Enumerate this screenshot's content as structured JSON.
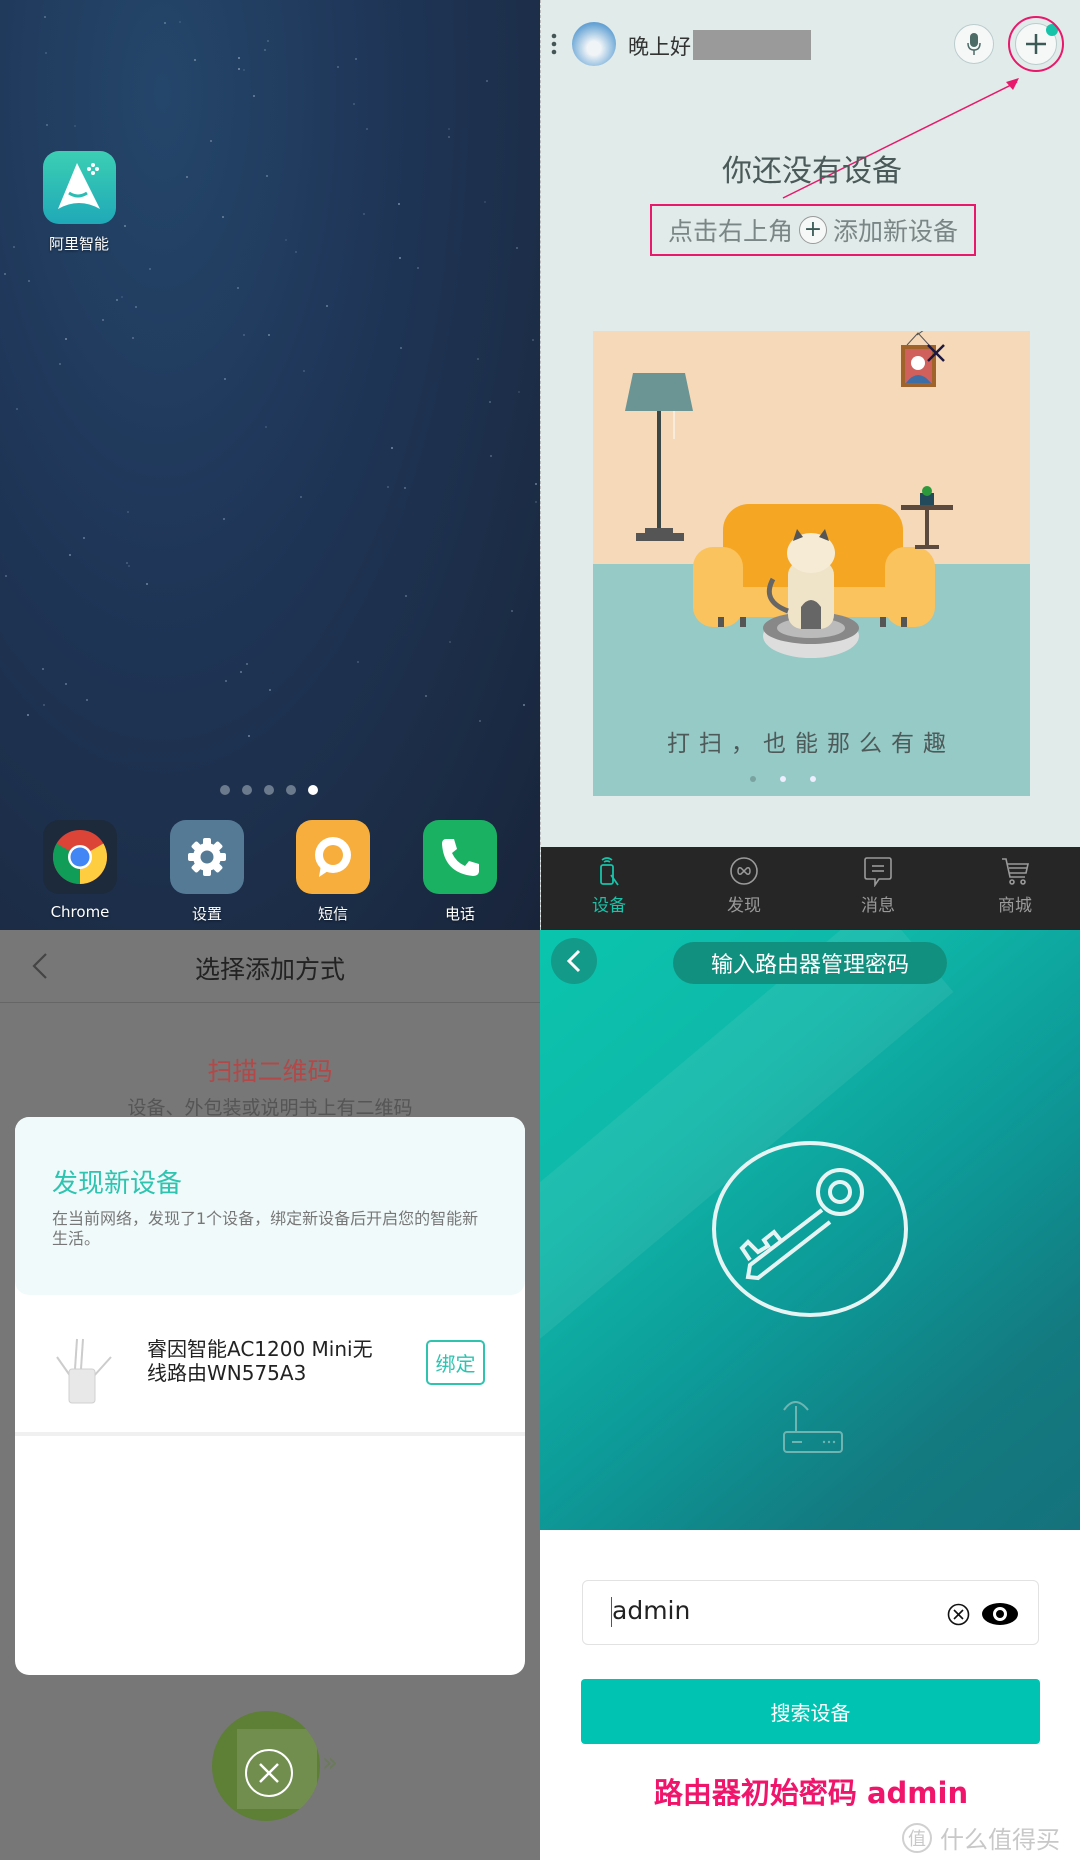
{
  "home_screen": {
    "app_icon_label": "阿里智能",
    "page_dots": {
      "count": 5,
      "active_index": 4
    },
    "dock": [
      {
        "label": "Chrome",
        "icon": "chrome-icon"
      },
      {
        "label": "设置",
        "icon": "gear-icon",
        "color": "#557a96"
      },
      {
        "label": "短信",
        "icon": "message-bubble-icon",
        "color": "#f7ae3c"
      },
      {
        "label": "电话",
        "icon": "phone-icon",
        "color": "#1bb163"
      }
    ]
  },
  "device_home": {
    "greeting": "晚上好",
    "empty_title": "你还没有设备",
    "hint_before": "点击右上角",
    "hint_after": "添加新设备",
    "banner": {
      "caption": "打扫，也能那么有趣",
      "dots": 3,
      "active_dot": 0
    },
    "nav": [
      {
        "label": "设备",
        "icon": "device-remote-icon",
        "active": true
      },
      {
        "label": "发现",
        "icon": "discover-icon",
        "active": false
      },
      {
        "label": "消息",
        "icon": "message-icon",
        "active": false
      },
      {
        "label": "商城",
        "icon": "cart-icon",
        "active": false
      }
    ],
    "accent": "#17c3a9",
    "annotation_color": "#e8186b"
  },
  "add_method": {
    "title": "选择添加方式",
    "scan_title": "扫描二维码",
    "scan_desc": "设备、外包装或说明书上有二维码",
    "dialog": {
      "title": "发现新设备",
      "desc": "在当前网络，发现了1个设备，绑定新设备后开启您的智能新生活。",
      "device_name_line1": "睿因智能AC1200 Mini无",
      "device_name_line2": "线路由WN575A3",
      "bind_label": "绑定"
    }
  },
  "router_password": {
    "title": "输入路由器管理密码",
    "password_value": "admin",
    "search_button": "搜索设备",
    "note": "路由器初始密码 admin",
    "button_color": "#00c4b1",
    "note_color": "#f0146a"
  },
  "watermark": {
    "badge": "值",
    "text": "什么值得买"
  }
}
